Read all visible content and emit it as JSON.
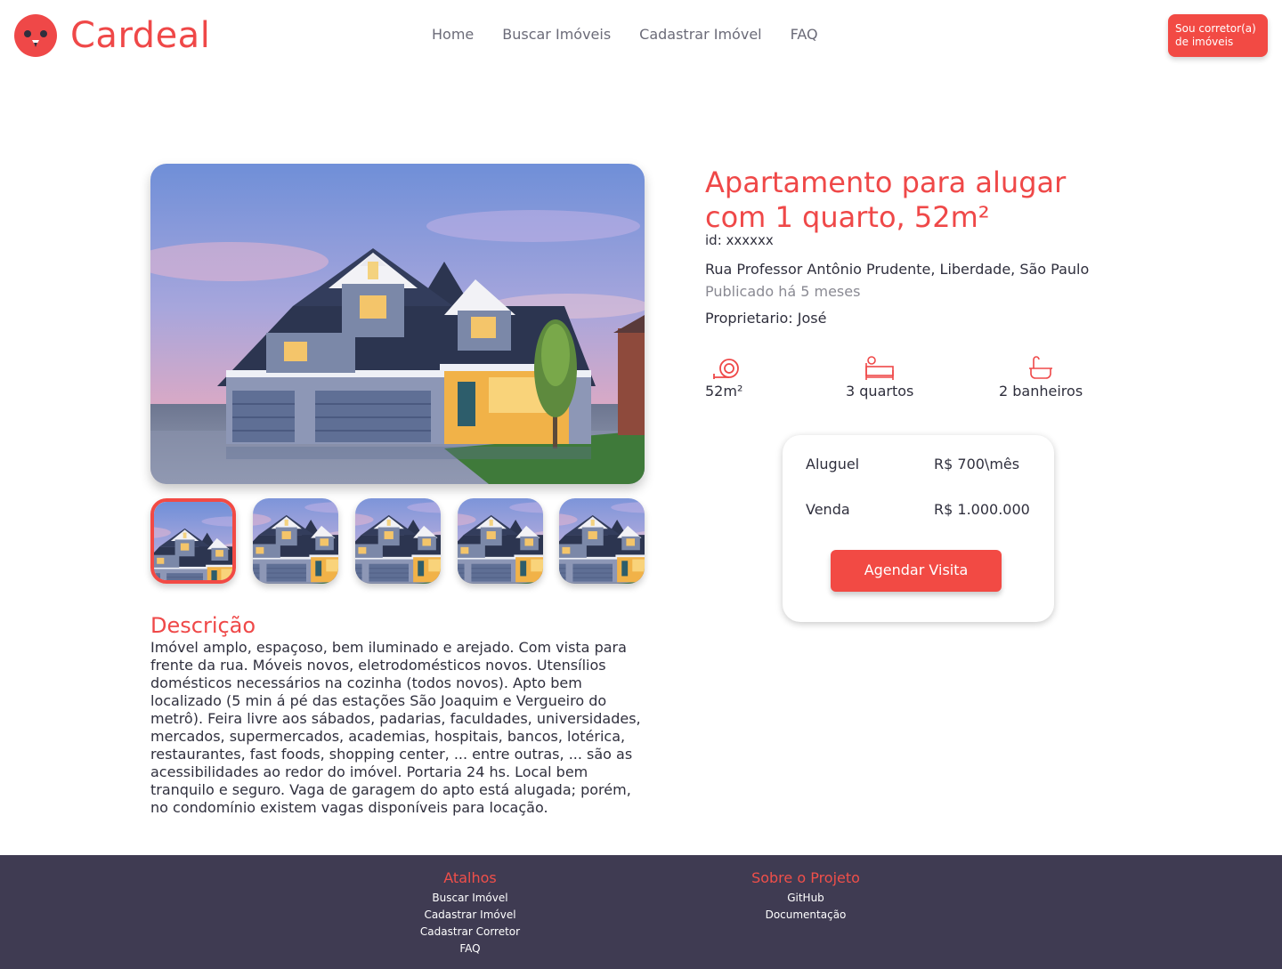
{
  "header": {
    "brand": "Cardeal",
    "nav": [
      "Home",
      "Buscar Imóveis",
      "Cadastrar Imóvel",
      "FAQ"
    ],
    "broker_button": "Sou corretor(a) de imóveis"
  },
  "listing": {
    "title": "Apartamento para alugar com 1 quarto, 52m²",
    "id": "id: xxxxxx",
    "address": "Rua Professor Antônio Prudente, Liberdade, São Paulo",
    "published": "Publicado há 5 meses",
    "owner": "Proprietario: José",
    "features": [
      {
        "icon": "area-tape-icon",
        "label": "52m²"
      },
      {
        "icon": "bed-icon",
        "label": "3 quartos"
      },
      {
        "icon": "bathtub-icon",
        "label": "2 banheiros"
      }
    ]
  },
  "gallery": {
    "thumbnail_count": 5,
    "active_index": 0
  },
  "pricing": {
    "rent_label": "Aluguel",
    "rent_value": "R$ 700\\mês",
    "sale_label": "Venda",
    "sale_value": "R$ 1.000.000",
    "visit_button": "Agendar Visita"
  },
  "description": {
    "title": "Descrição",
    "text": "Imóvel amplo, espaçoso, bem iluminado e arejado. Com vista para frente da rua. Móveis novos, eletrodomésticos novos. Utensílios domésticos necessários na cozinha (todos novos). Apto bem localizado (5 min á pé das estações São Joaquim e Vergueiro do metrô). Feira livre aos sábados, padarias, faculdades, universidades, mercados, supermercados, academias, hospitais, bancos, lotérica, restaurantes, fast foods, shopping center, ... entre outras, ... são as acessibilidades ao redor do imóvel. Portaria 24 hs. Local bem tranquilo e seguro. Vaga de garagem do apto está alugada; porém, no condomínio existem vagas disponíveis para locação."
  },
  "footer": {
    "shortcuts_title": "Atalhos",
    "shortcuts": [
      "Buscar Imóvel",
      "Cadastrar Imóvel",
      "Cadastrar Corretor",
      "FAQ"
    ],
    "about_title": "Sobre o Projeto",
    "about_links": [
      "GitHub",
      "Documentação"
    ]
  },
  "colors": {
    "accent": "#f24a44",
    "footer_bg": "#3f3b52",
    "text": "#2f2f3d"
  }
}
